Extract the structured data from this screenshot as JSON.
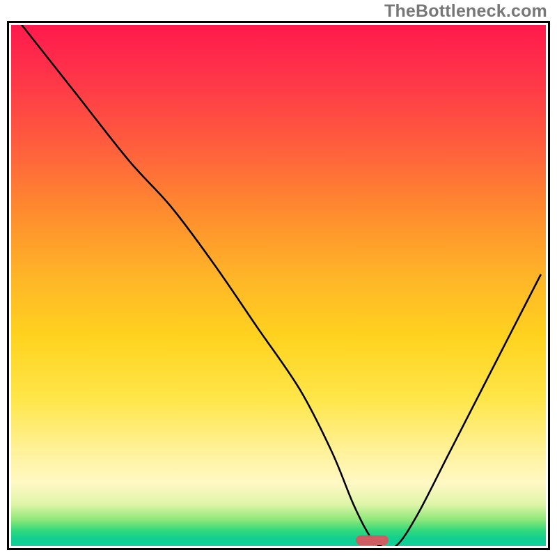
{
  "watermark": "TheBottleneck.com",
  "chart_data": {
    "type": "line",
    "title": "",
    "xlabel": "",
    "ylabel": "",
    "xlim": [
      0,
      100
    ],
    "ylim": [
      0,
      100
    ],
    "series": [
      {
        "name": "bottleneck-curve",
        "x": [
          2,
          12,
          22,
          30,
          38,
          46,
          54,
          60,
          64,
          67,
          69,
          72,
          76,
          82,
          90,
          99
        ],
        "y": [
          100,
          87,
          74,
          65,
          54,
          42,
          30,
          18,
          8,
          2,
          0,
          0,
          6,
          18,
          34,
          52
        ]
      }
    ],
    "marker": {
      "x_center": 67,
      "width_pct": 6,
      "color": "#ce5c63"
    },
    "background_gradient": {
      "stops": [
        {
          "pct": 0,
          "color": "#ff1a4d"
        },
        {
          "pct": 36,
          "color": "#ff8c2e"
        },
        {
          "pct": 72,
          "color": "#ffe64a"
        },
        {
          "pct": 95,
          "color": "#8de77a"
        },
        {
          "pct": 100,
          "color": "#0fd19b"
        }
      ]
    }
  }
}
